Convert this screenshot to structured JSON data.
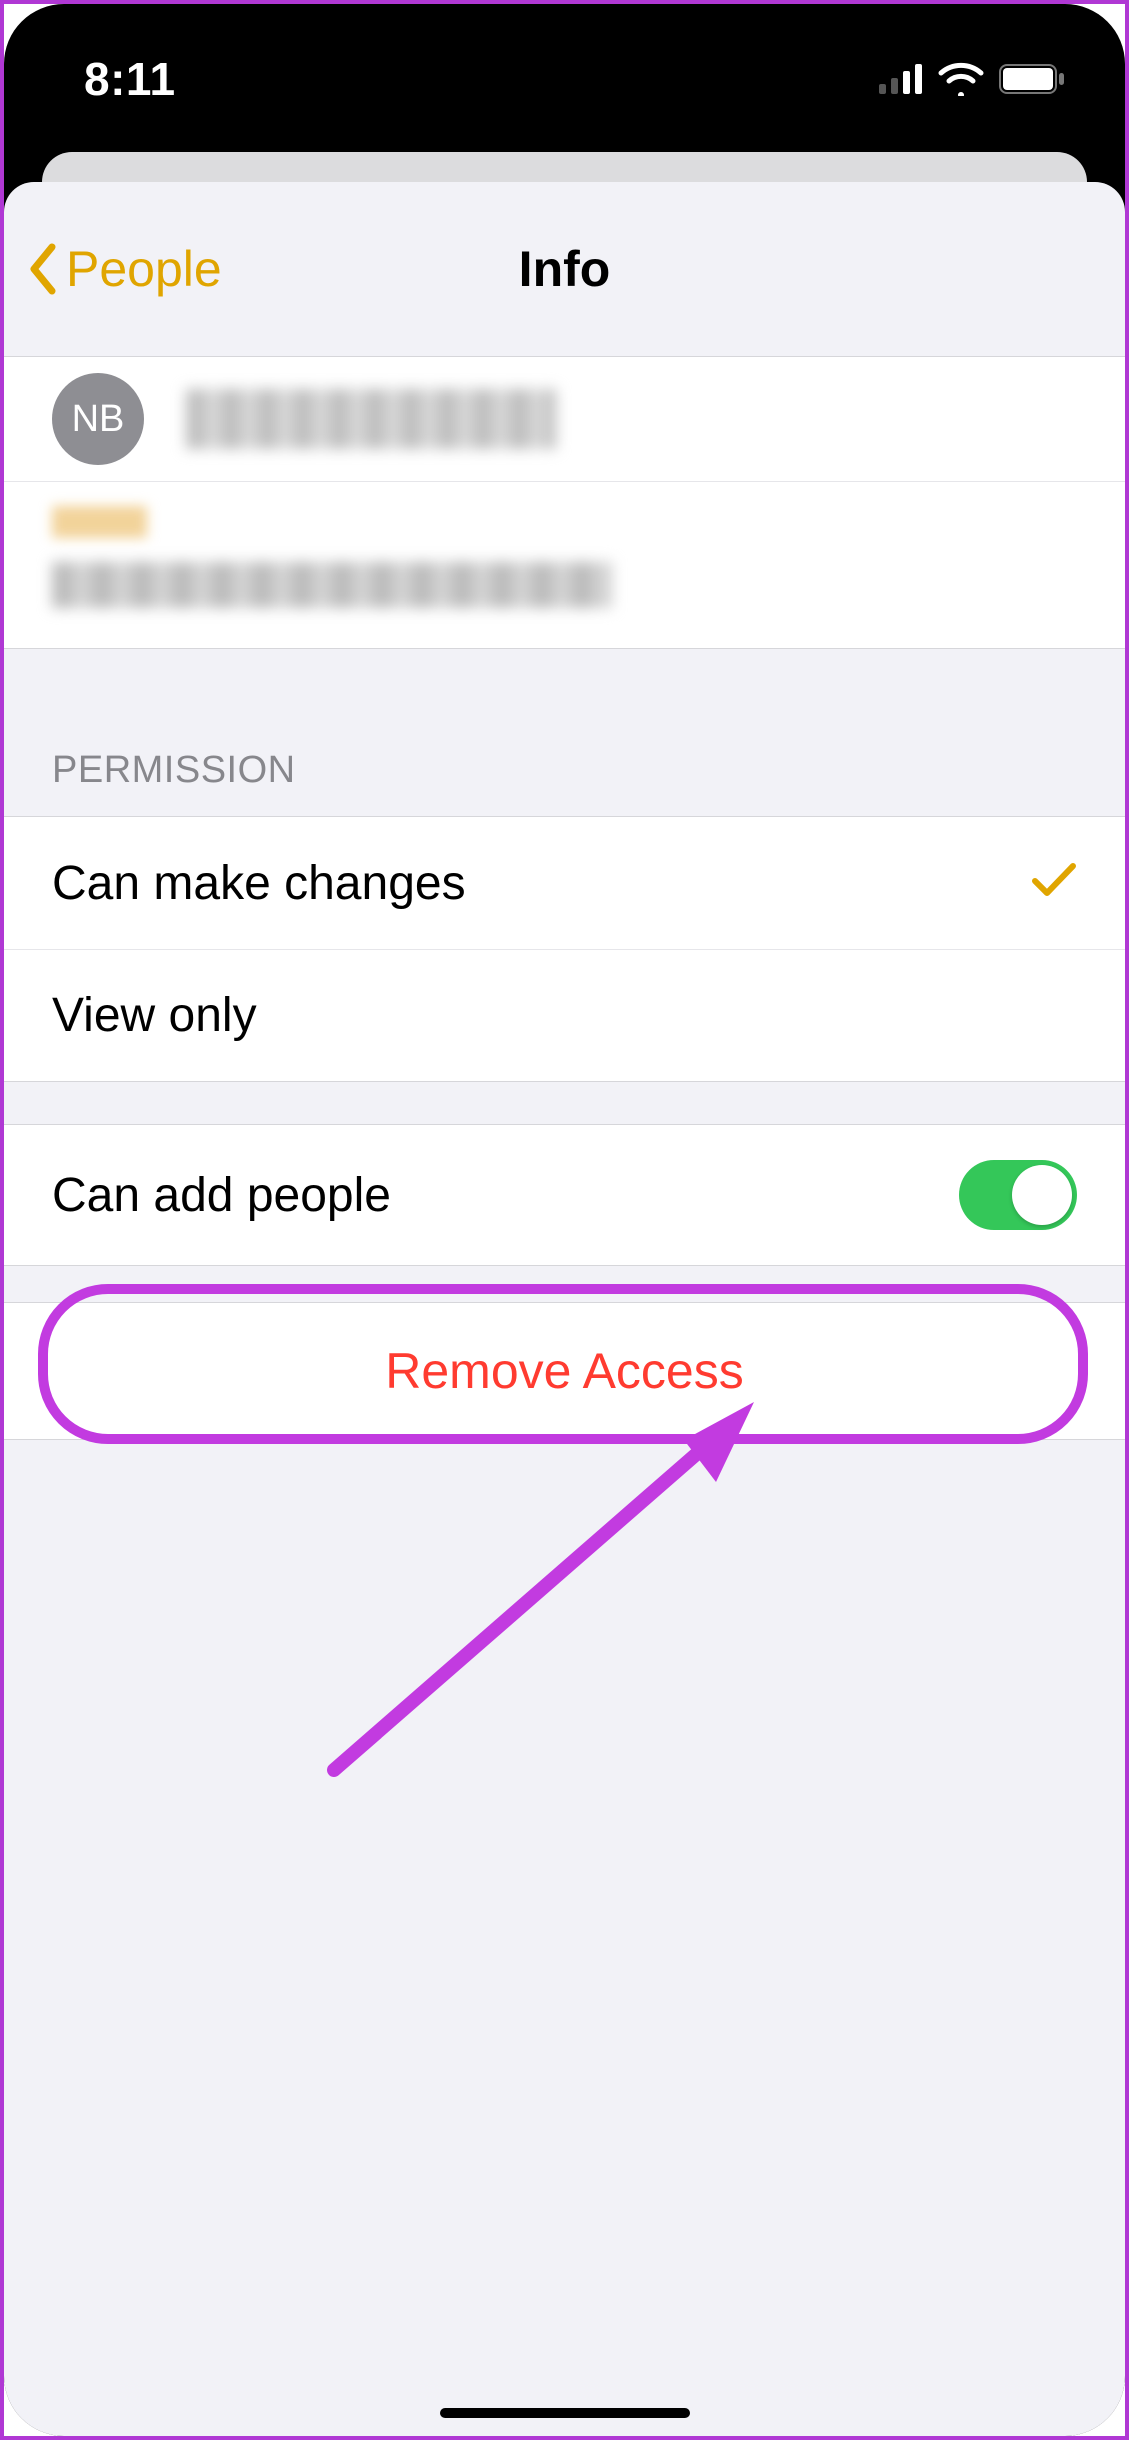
{
  "status": {
    "time": "8:11"
  },
  "nav": {
    "back_label": "People",
    "title": "Info"
  },
  "person": {
    "avatar_initials": "NB"
  },
  "permission": {
    "header": "PERMISSION",
    "can_make_changes_label": "Can make changes",
    "view_only_label": "View only",
    "selected": "can_make_changes"
  },
  "can_add_people": {
    "label": "Can add people",
    "value": true
  },
  "remove_access_label": "Remove Access"
}
